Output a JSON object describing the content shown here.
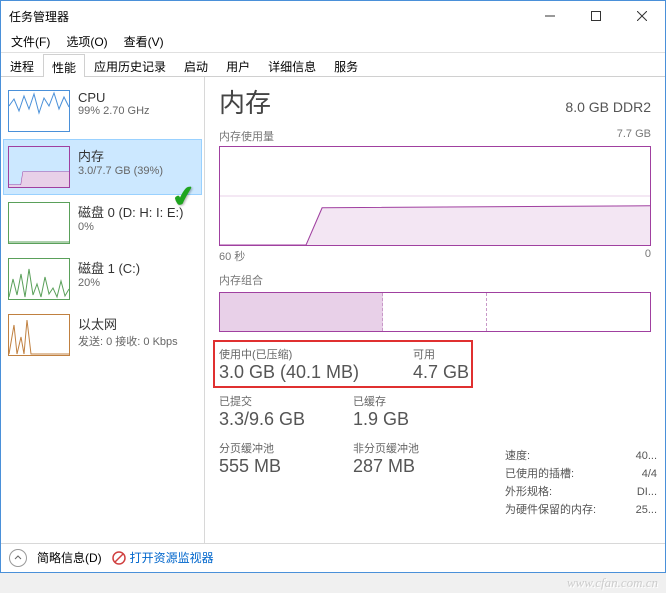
{
  "window": {
    "title": "任务管理器"
  },
  "menu": {
    "file": "文件(F)",
    "options": "选项(O)",
    "view": "查看(V)"
  },
  "tabs": [
    "进程",
    "性能",
    "应用历史记录",
    "启动",
    "用户",
    "详细信息",
    "服务"
  ],
  "active_tab": 1,
  "sidebar": {
    "items": [
      {
        "name": "CPU",
        "detail": "99%  2.70 GHz"
      },
      {
        "name": "内存",
        "detail": "3.0/7.7 GB (39%)"
      },
      {
        "name": "磁盘 0 (D: H: I: E:)",
        "detail": "0%"
      },
      {
        "name": "磁盘 1 (C:)",
        "detail": "20%"
      },
      {
        "name": "以太网",
        "detail": "发送: 0 接收: 0 Kbps"
      }
    ],
    "selected": 1
  },
  "main": {
    "title": "内存",
    "subtitle": "8.0 GB DDR2",
    "usage_label": "内存使用量",
    "usage_max": "7.7 GB",
    "axis_left": "60 秒",
    "axis_right": "0",
    "composition_label": "内存组合",
    "stats": {
      "in_use_label": "使用中(已压缩)",
      "in_use_value": "3.0 GB (40.1 MB)",
      "available_label": "可用",
      "available_value": "4.7 GB",
      "committed_label": "已提交",
      "committed_value": "3.3/9.6 GB",
      "cached_label": "已缓存",
      "cached_value": "1.9 GB",
      "paged_label": "分页缓冲池",
      "paged_value": "555 MB",
      "nonpaged_label": "非分页缓冲池",
      "nonpaged_value": "287 MB"
    },
    "info": {
      "speed_label": "速度:",
      "speed_value": "40...",
      "slots_label": "已使用的插槽:",
      "slots_value": "4/4",
      "form_label": "外形规格:",
      "form_value": "DI...",
      "reserved_label": "为硬件保留的内存:",
      "reserved_value": "25..."
    }
  },
  "footer": {
    "brief": "简略信息(D)",
    "monitor": "打开资源监视器"
  },
  "watermark": "www.cfan.com.cn",
  "chart_data": {
    "type": "area",
    "title": "内存使用量",
    "ylabel": "GB",
    "ylim": [
      0,
      7.7
    ],
    "xlabel": "秒",
    "xlim": [
      60,
      0
    ],
    "series": [
      {
        "name": "内存",
        "values_gb_approx": [
          0,
          0,
          0,
          0,
          0,
          0,
          0,
          0,
          0,
          0,
          0,
          0,
          2.8,
          3.0,
          3.0,
          3.0,
          3.0,
          3.0,
          3.0,
          3.0,
          3.0,
          3.0,
          3.0,
          3.0,
          3.0,
          3.0,
          3.0,
          3.0,
          3.0,
          3.0
        ]
      }
    ]
  }
}
